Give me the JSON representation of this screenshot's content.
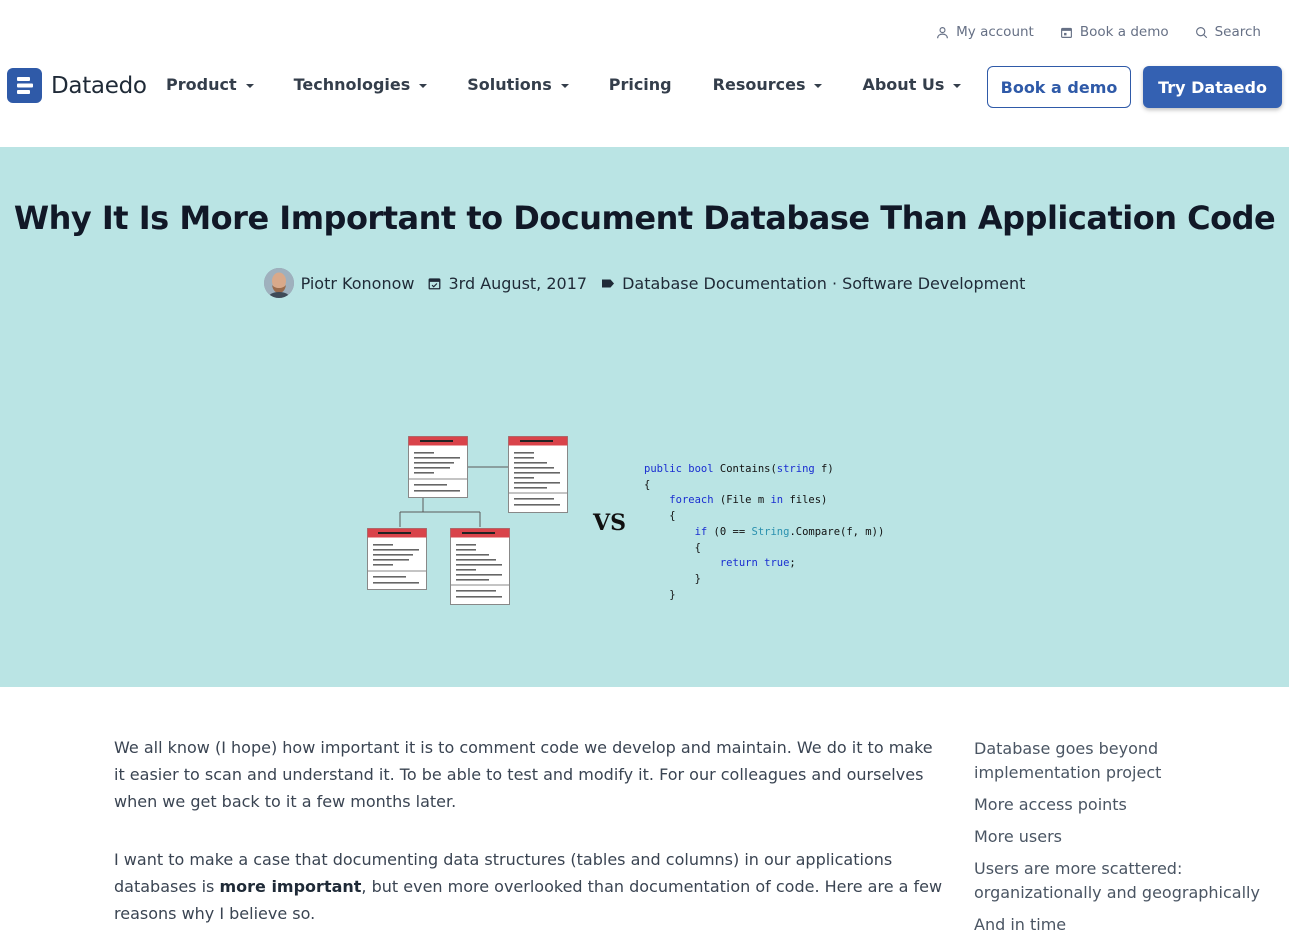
{
  "topbar": {
    "account_label": "My account",
    "demo_label": "Book a demo",
    "search_label": "Search"
  },
  "nav": {
    "logo_text": "Dataedo",
    "items": [
      {
        "label": "Product",
        "dropdown": true
      },
      {
        "label": "Technologies",
        "dropdown": true
      },
      {
        "label": "Solutions",
        "dropdown": true
      },
      {
        "label": "Pricing",
        "dropdown": false
      },
      {
        "label": "Resources",
        "dropdown": true
      },
      {
        "label": "About Us",
        "dropdown": true
      }
    ],
    "book_demo_label": "Book a demo",
    "try_label": "Try Dataedo"
  },
  "hero": {
    "title": "Why It Is More Important to Document Database Than Application Code",
    "author": "Piotr Kononow",
    "date": "3rd August, 2017",
    "categories": "Database Documentation · Software Development",
    "vs_label": "VS",
    "code_lines": [
      "public bool Contains(string f)",
      "{",
      "    foreach (File m in files)",
      "    {",
      "        if (0 == String.Compare(f, m))",
      "        {",
      "            return true;",
      "        }",
      "    }"
    ]
  },
  "article": {
    "p1": "We all know (I hope) how important it is to comment code we develop and maintain. We do it to make it easier to scan and understand it. To be able to test and modify it. For our colleagues and ourselves when we get back to it a few months later.",
    "p2_before": "I want to make a case that documenting data structures (tables and columns) in our applications databases is ",
    "p2_bold": "more important",
    "p2_after": ", but even more overlooked than documentation of code. Here are a few reasons why I believe so."
  },
  "toc": [
    "Database goes beyond implementation project",
    "More access points",
    "More users",
    "Users are more scattered: organizationally and geographically",
    "And in time"
  ],
  "colors": {
    "brand": "#2f5aa8",
    "hero_bg": "#bae4e4",
    "table_header": "#d9434a"
  }
}
